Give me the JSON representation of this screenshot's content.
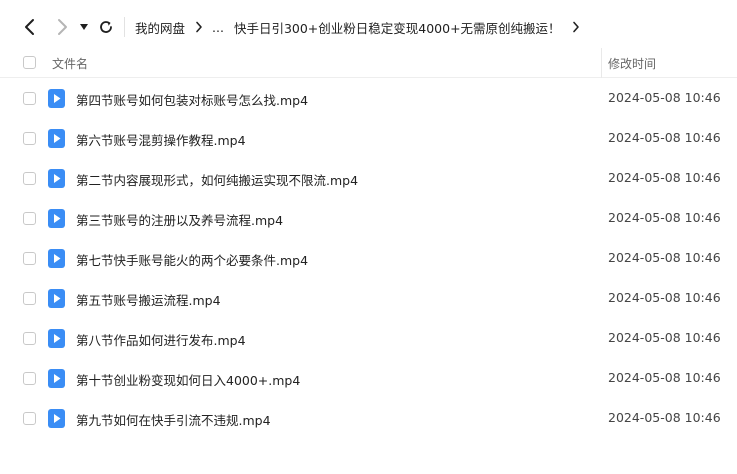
{
  "breadcrumb": {
    "root": "我的网盘",
    "ellipsis": "...",
    "current": "快手日引300+创业粉日稳定变现4000+无需原创纯搬运！"
  },
  "header": {
    "name_label": "文件名",
    "time_label": "修改时间"
  },
  "files": [
    {
      "name": "第四节账号如何包装对标账号怎么找.mp4",
      "modified": "2024-05-08 10:46",
      "icon": "video-file-icon"
    },
    {
      "name": "第六节账号混剪操作教程.mp4",
      "modified": "2024-05-08 10:46",
      "icon": "video-file-icon"
    },
    {
      "name": "第二节内容展现形式，如何纯搬运实现不限流.mp4",
      "modified": "2024-05-08 10:46",
      "icon": "video-file-icon"
    },
    {
      "name": "第三节账号的注册以及养号流程.mp4",
      "modified": "2024-05-08 10:46",
      "icon": "video-file-icon"
    },
    {
      "name": "第七节快手账号能火的两个必要条件.mp4",
      "modified": "2024-05-08 10:46",
      "icon": "video-file-icon"
    },
    {
      "name": "第五节账号搬运流程.mp4",
      "modified": "2024-05-08 10:46",
      "icon": "video-file-icon"
    },
    {
      "name": "第八节作品如何进行发布.mp4",
      "modified": "2024-05-08 10:46",
      "icon": "video-file-icon"
    },
    {
      "name": "第十节创业粉变现如何日入4000+.mp4",
      "modified": "2024-05-08 10:46",
      "icon": "video-file-icon"
    },
    {
      "name": "第九节如何在快手引流不违规.mp4",
      "modified": "2024-05-08 10:46",
      "icon": "video-file-icon"
    }
  ],
  "colors": {
    "file_icon": "#3a8df5",
    "divider": "#eeeeee",
    "text_primary": "#222222",
    "text_secondary": "#666666"
  }
}
